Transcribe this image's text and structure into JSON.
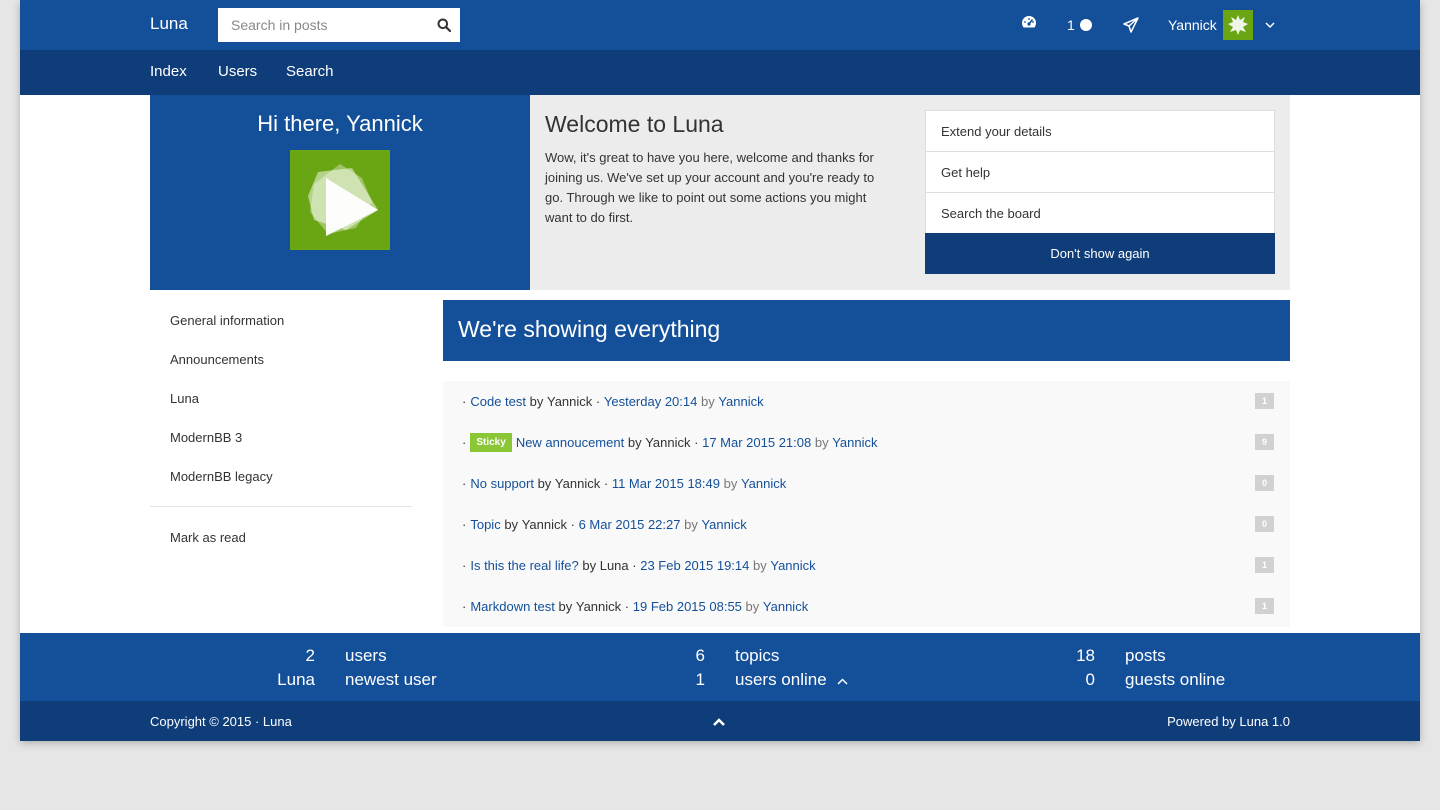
{
  "header": {
    "brand": "Luna",
    "search_placeholder": "Search in posts",
    "notifications_count": "1",
    "username": "Yannick"
  },
  "nav": [
    "Index",
    "Users",
    "Search"
  ],
  "hero": {
    "greeting": "Hi there, Yannick",
    "welcome_title": "Welcome to Luna",
    "welcome_text": "Wow, it's great to have you here, welcome and thanks for joining us. We've set up your account and you're ready to go. Through we like to point out some actions you might want to do first.",
    "actions": [
      "Extend your details",
      "Get help",
      "Search the board"
    ],
    "dont_show": "Don't show again"
  },
  "sidebar": {
    "items": [
      "General information",
      "Announcements",
      "Luna",
      "ModernBB 3",
      "ModernBB legacy"
    ],
    "mark_as_read": "Mark as read"
  },
  "banner_title": "We're showing everything",
  "topics": [
    {
      "title": "Code test",
      "sticky": false,
      "author": "Yannick",
      "date": "Yesterday 20:14",
      "last_by": "Yannick",
      "replies": "1"
    },
    {
      "title": "New annoucement",
      "sticky": true,
      "sticky_label": "Sticky",
      "author": "Yannick",
      "date": "17 Mar 2015 21:08",
      "last_by": "Yannick",
      "replies": "9"
    },
    {
      "title": "No support",
      "sticky": false,
      "author": "Yannick",
      "date": "11 Mar 2015 18:49",
      "last_by": "Yannick",
      "replies": "0"
    },
    {
      "title": "Topic",
      "sticky": false,
      "author": "Yannick",
      "date": "6 Mar 2015 22:27",
      "last_by": "Yannick",
      "replies": "0"
    },
    {
      "title": "Is this the real life?",
      "sticky": false,
      "author": "Luna",
      "date": "23 Feb 2015 19:14",
      "last_by": "Yannick",
      "replies": "1"
    },
    {
      "title": "Markdown test",
      "sticky": false,
      "author": "Yannick",
      "date": "19 Feb 2015 08:55",
      "last_by": "Yannick",
      "replies": "1"
    }
  ],
  "topic_words": {
    "dot": "·",
    "by": "by",
    "sep": "·"
  },
  "stats": {
    "users": {
      "value": "2",
      "label": "users"
    },
    "newest": {
      "value": "Luna",
      "label": "newest user"
    },
    "topics": {
      "value": "6",
      "label": "topics"
    },
    "online": {
      "value": "1",
      "label": "users online"
    },
    "posts": {
      "value": "18",
      "label": "posts"
    },
    "guests": {
      "value": "0",
      "label": "guests online"
    }
  },
  "footer": {
    "copyright": "Copyright © 2015 · Luna",
    "powered": "Powered by Luna 1.0"
  },
  "colors": {
    "primary": "#14509a",
    "primary_dark": "#0f3d7a",
    "avatar_green": "#6aa513",
    "sticky_green": "#8ac635"
  },
  "icons": [
    "search-icon",
    "dashboard-icon",
    "notification-dot-icon",
    "send-icon",
    "chevron-down-icon",
    "chevron-up-icon"
  ]
}
